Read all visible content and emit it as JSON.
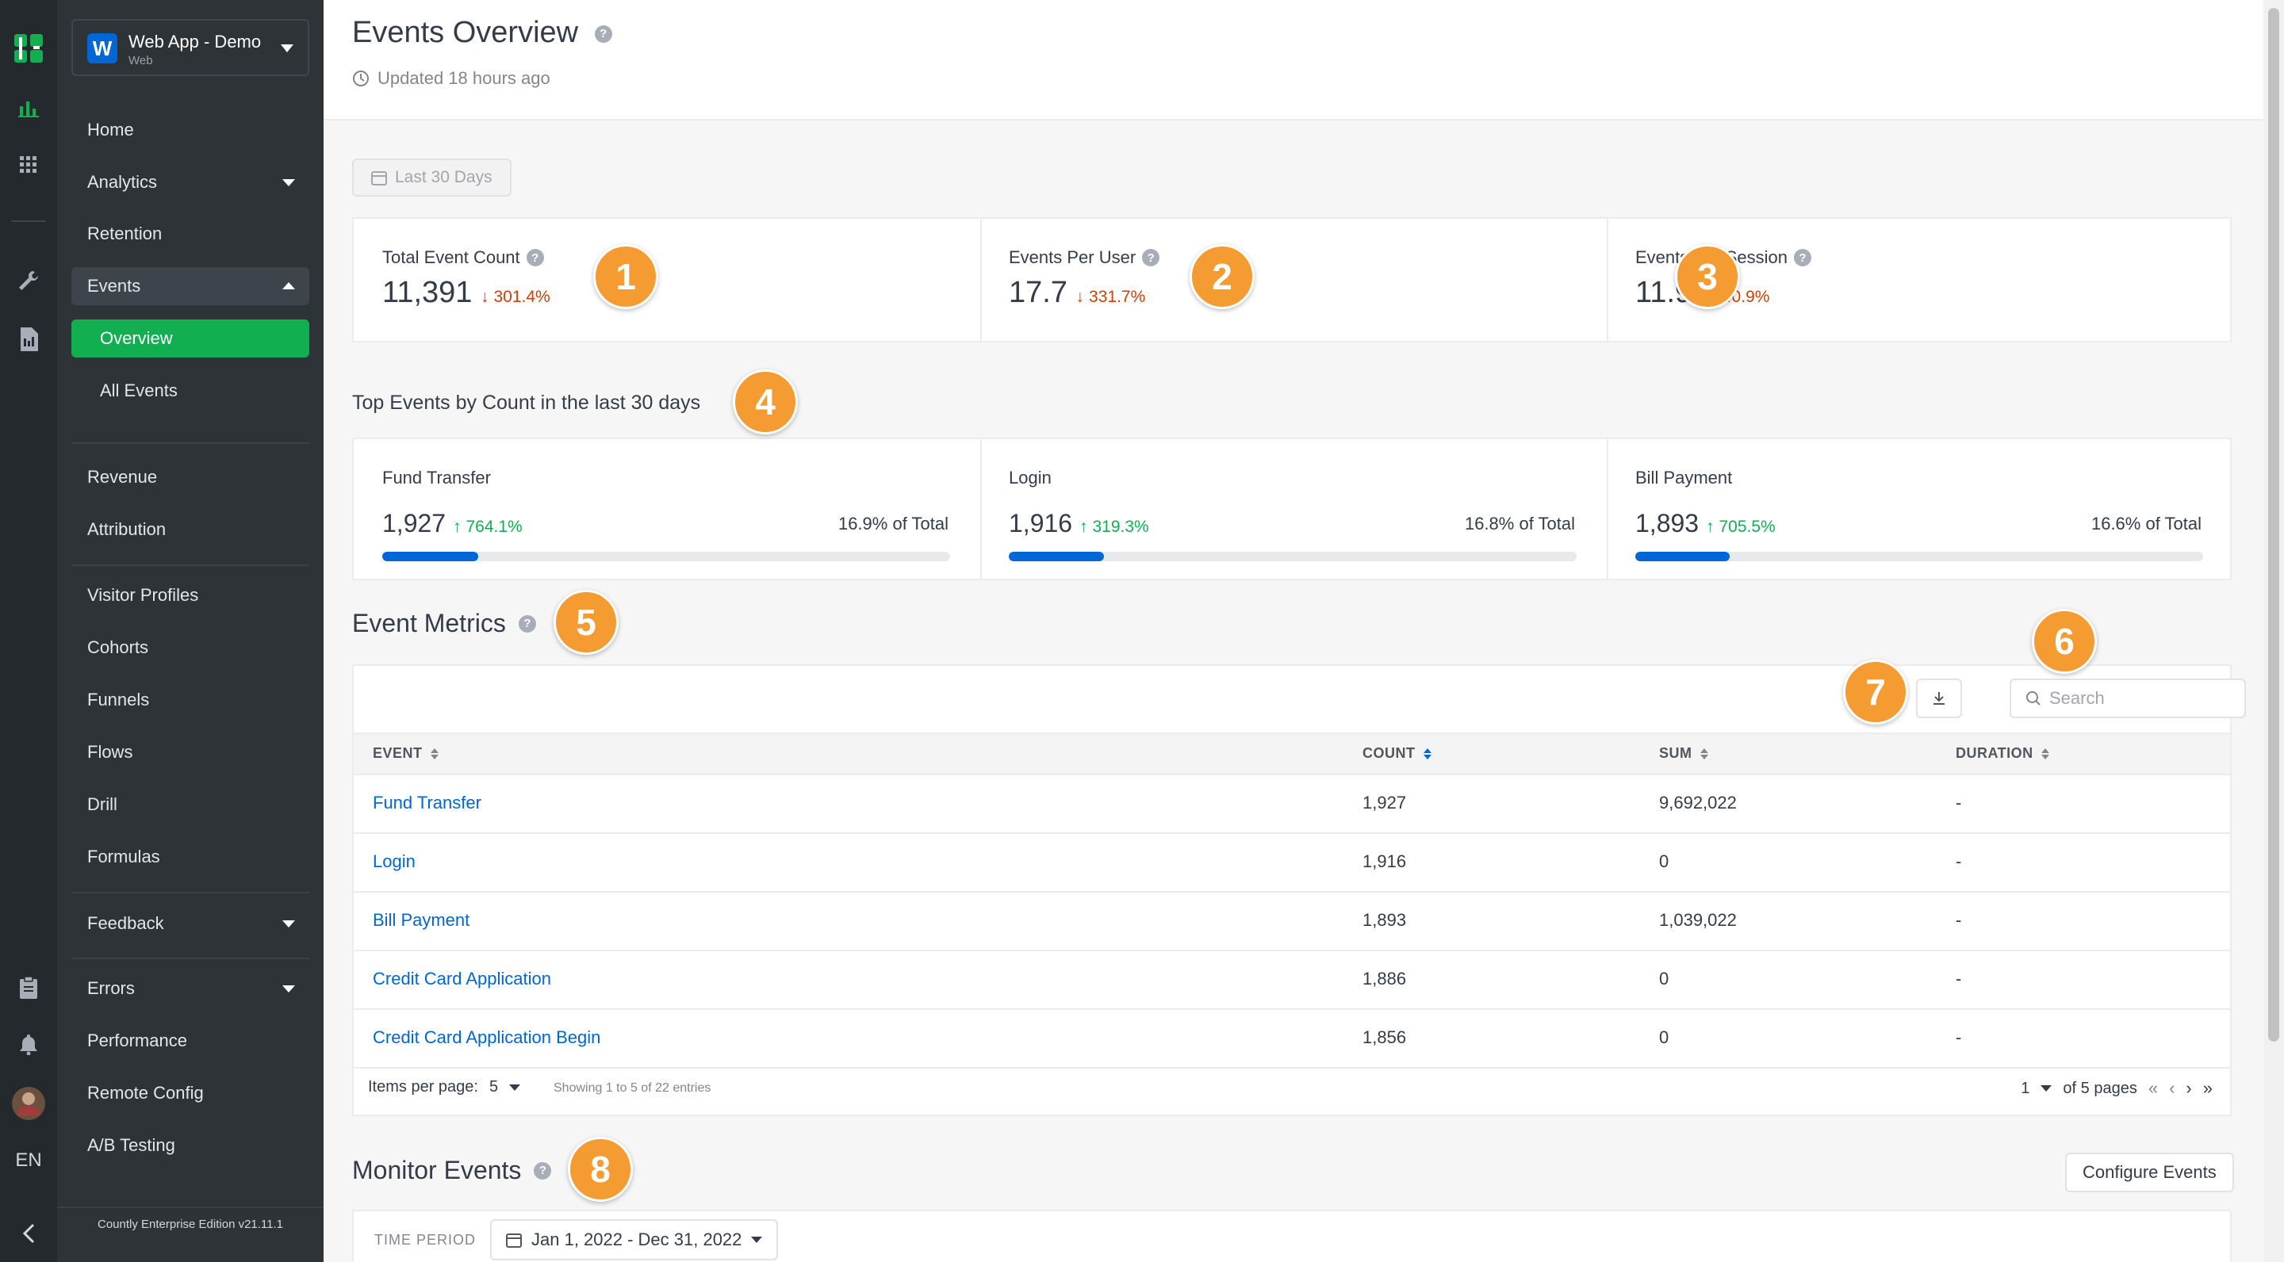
{
  "rail": {
    "lang": "EN"
  },
  "app": {
    "logo_letter": "W",
    "name": "Web App - Demo",
    "type": "Web"
  },
  "nav": {
    "home": "Home",
    "analytics": "Analytics",
    "retention": "Retention",
    "events": "Events",
    "overview": "Overview",
    "all_events": "All Events",
    "revenue": "Revenue",
    "attribution": "Attribution",
    "visitor_profiles": "Visitor Profiles",
    "cohorts": "Cohorts",
    "funnels": "Funnels",
    "flows": "Flows",
    "drill": "Drill",
    "formulas": "Formulas",
    "feedback": "Feedback",
    "errors": "Errors",
    "performance": "Performance",
    "remote_config": "Remote Config",
    "ab_testing": "A/B Testing"
  },
  "edition": "Countly Enterprise Edition v21.11.1",
  "header": {
    "title": "Events Overview",
    "help": "?",
    "updated": "Updated 18 hours ago"
  },
  "date_range": "Last 30 Days",
  "metrics": [
    {
      "label": "Total Event Count",
      "value": "11,391",
      "change": "301.4%",
      "direction": "down"
    },
    {
      "label": "Events Per User",
      "value": "17.7",
      "change": "331.7%",
      "direction": "down"
    },
    {
      "label": "Events Per Session",
      "value": "11.9",
      "change": "440.9%",
      "direction": "down"
    }
  ],
  "top_events": {
    "title": "Top Events by Count in the last 30 days",
    "items": [
      {
        "name": "Fund Transfer",
        "value": "1,927",
        "change": "764.1%",
        "direction": "up",
        "share_label": "16.9% of Total",
        "share": 16.9
      },
      {
        "name": "Login",
        "value": "1,916",
        "change": "319.3%",
        "direction": "up",
        "share_label": "16.8% of Total",
        "share": 16.8
      },
      {
        "name": "Bill Payment",
        "value": "1,893",
        "change": "705.5%",
        "direction": "up",
        "share_label": "16.6% of Total",
        "share": 16.6
      }
    ]
  },
  "event_metrics": {
    "title": "Event Metrics",
    "search_placeholder": "Search",
    "columns": {
      "event": "EVENT",
      "count": "COUNT",
      "sum": "SUM",
      "duration": "DURATION"
    },
    "rows": [
      {
        "event": "Fund Transfer",
        "count": "1,927",
        "sum": "9,692,022",
        "duration": "-"
      },
      {
        "event": "Login",
        "count": "1,916",
        "sum": "0",
        "duration": "-"
      },
      {
        "event": "Bill Payment",
        "count": "1,893",
        "sum": "1,039,022",
        "duration": "-"
      },
      {
        "event": "Credit Card Application",
        "count": "1,886",
        "sum": "0",
        "duration": "-"
      },
      {
        "event": "Credit Card Application Begin",
        "count": "1,856",
        "sum": "0",
        "duration": "-"
      }
    ],
    "items_per_page_label": "Items per page:",
    "items_per_page": "5",
    "showing": "Showing 1 to 5 of 22 entries",
    "page": "1",
    "of_pages": "of 5 pages"
  },
  "monitor": {
    "title": "Monitor Events",
    "configure_label": "Configure Events",
    "time_period_label": "TIME PERIOD",
    "time_period_value": "Jan 1, 2022 - Dec 31, 2022"
  },
  "badges": [
    "1",
    "2",
    "3",
    "4",
    "5",
    "6",
    "7",
    "8"
  ],
  "colors": {
    "accent_green": "#12af51",
    "accent_blue": "#0166d6",
    "badge_orange": "#f49b32",
    "trend_down": "#d23f00"
  }
}
